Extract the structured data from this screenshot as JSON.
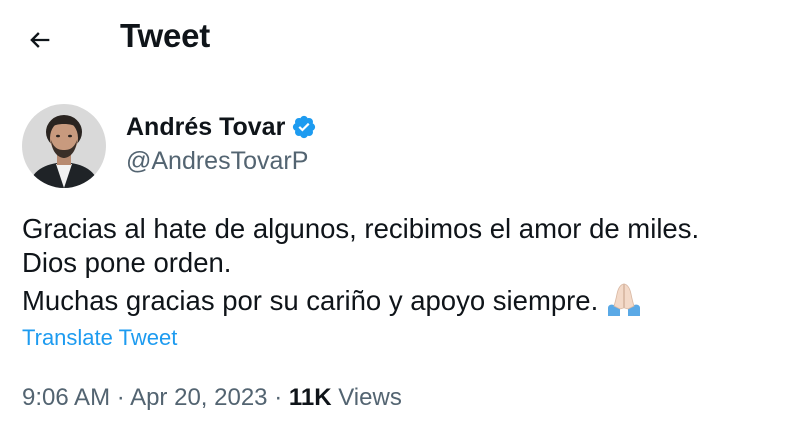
{
  "header": {
    "title": "Tweet",
    "back_icon": "arrow-left-icon"
  },
  "author": {
    "display_name": "Andrés Tovar",
    "handle": "@AndresTovarP",
    "verified": true,
    "verified_icon": "verified-badge-icon",
    "verified_color": "#1d9bf0"
  },
  "tweet": {
    "lines": [
      "Gracias al hate de algunos, recibimos el amor de miles.",
      "Dios pone orden.",
      "Muchas gracias por su cariño y apoyo siempre."
    ],
    "emoji": "folded-hands-emoji"
  },
  "translate_label": "Translate Tweet",
  "meta": {
    "time": "9:06 AM",
    "separator": "·",
    "date": "Apr 20, 2023",
    "views_count": "11K",
    "views_label": "Views"
  },
  "colors": {
    "text": "#0f1419",
    "secondary": "#536471",
    "accent": "#1d9bf0"
  }
}
